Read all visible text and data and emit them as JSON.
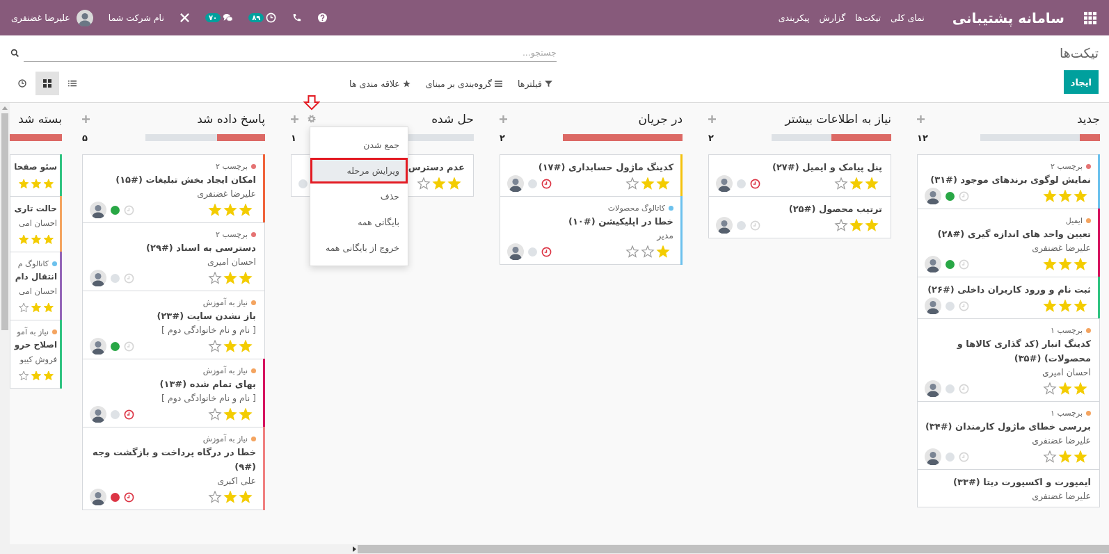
{
  "navbar": {
    "brand": "سامانه پشتیبانی",
    "menu": [
      "نمای کلی",
      "تیکت‌ها",
      "گزارش",
      "پیکربندی"
    ],
    "systray": [
      {
        "kind": "help"
      },
      {
        "kind": "phone"
      },
      {
        "kind": "activities",
        "badge": "۸۹"
      },
      {
        "kind": "messages",
        "badge": "۷۰"
      },
      {
        "kind": "tools"
      },
      {
        "kind": "company",
        "label": "نام شرکت شما"
      },
      {
        "kind": "user",
        "label": "علیرضا غضنفری"
      }
    ]
  },
  "control_panel": {
    "title": "تیکت‌ها",
    "search": {
      "placeholder": "جستجو..."
    },
    "create_button": "ایجاد",
    "filters": [
      {
        "kind": "filter",
        "label": "فیلترها"
      },
      {
        "kind": "group",
        "label": "گروه‌بندی بر مبنای"
      },
      {
        "kind": "favorite",
        "label": "علاقه مندی ها"
      }
    ],
    "views": [
      {
        "kind": "list",
        "selected": false
      },
      {
        "kind": "kanban",
        "selected": true
      },
      {
        "kind": "activity",
        "selected": false
      }
    ]
  },
  "columns": [
    {
      "title": "جدید",
      "count": "۱۲",
      "level": 0.17,
      "add_button": true,
      "cards": [
        {
          "tag": {
            "label": "برچسب ۲",
            "color": "#e57373"
          },
          "title": "نمایش لوگوی برندهای موجود (#۳۱)",
          "stars": 3,
          "status_dot": {
            "color": "#28a745"
          },
          "overdue": false,
          "avatar": true,
          "color": "#6cc1ed"
        },
        {
          "tag": {
            "label": "ایمیل",
            "color": "#f4a460"
          },
          "title": "تعیین واحد های اندازه گیری (#۲۸)",
          "person": "علیرضا غضنفری",
          "stars": 3,
          "status_dot": {
            "color": "#28a745"
          },
          "overdue": false,
          "avatar": true,
          "color": "#d6145f"
        },
        {
          "title": "ثبت نام و ورود کاربران داخلی (#۲۶)",
          "stars": 3,
          "status_dot": {
            "color": "#dee2e6"
          },
          "overdue": false,
          "avatar": true,
          "color": "#30c381"
        },
        {
          "tag": {
            "label": "برچسب ۱",
            "color": "#f4a460"
          },
          "title": "کدینگ انبار (کد گذاری کالاها و محصولات) (#۳۵)",
          "person": "احسان امیری",
          "stars": 2,
          "status_dot": {
            "color": "#dee2e6"
          },
          "overdue": false,
          "avatar": true
        },
        {
          "tag": {
            "label": "برچسب ۱",
            "color": "#f4a460"
          },
          "title": "بررسی خطای ماژول کارمندان (#۳۴)",
          "person": "علیرضا غضنفری",
          "stars": 2,
          "status_dot": {
            "color": "#dee2e6"
          },
          "overdue": false,
          "avatar": true
        },
        {
          "title": "ایمپورت و اکسپورت دیتا (#۳۳)",
          "person": "علیرضا غضنفری"
        }
      ]
    },
    {
      "title": "نیاز به اطلاعات بیشتر",
      "count": "۲",
      "level": 0.5,
      "add_button": true,
      "cards": [
        {
          "title": "پنل پیامک و ایمیل (#۲۷)",
          "stars": 2,
          "status_dot": {
            "color": "#dee2e6"
          },
          "overdue": true,
          "avatar": true
        },
        {
          "title": "ترتیب محصول (#۲۵)",
          "stars": 2,
          "status_dot": {
            "color": "#dee2e6"
          },
          "overdue": false,
          "avatar": true
        }
      ]
    },
    {
      "title": "در جریان",
      "count": "۲",
      "level": 1,
      "add_button": true,
      "cards": [
        {
          "title": "کدینگ ماژول حسابداری (#۱۷)",
          "stars": 2,
          "status_dot": {
            "color": "#dee2e6"
          },
          "overdue": true,
          "avatar": true,
          "color": "#f4c20d"
        },
        {
          "tag": {
            "label": "کاتالوگ محصولات",
            "color": "#6cc1ed"
          },
          "title": "خطا در اپلیکیشن (#۱۰)",
          "person": "مدیر",
          "stars": 1,
          "status_dot": {
            "color": "#dee2e6"
          },
          "overdue": true,
          "avatar": true,
          "color": "#6cc1ed"
        }
      ]
    },
    {
      "title": "حل شده",
      "count": "۱",
      "level": 0,
      "add_button": true,
      "menu": [
        {
          "label": "جمع شدن",
          "selected": false
        },
        {
          "label": "ویرایش مرحله",
          "selected": true
        },
        {
          "label": "حذف",
          "selected": false
        },
        {
          "label": "بایگانی همه",
          "selected": false
        },
        {
          "label": "خروج از بایگانی همه",
          "selected": false
        }
      ],
      "cards": [
        {
          "title": "عدم دسترس",
          "stars": 2,
          "status_dot": {
            "color": "#dee2e6"
          },
          "avatar": false
        }
      ]
    },
    {
      "title": "پاسخ داده شد",
      "count": "۵",
      "level": 0.4,
      "add_button": true,
      "cards": [
        {
          "tag": {
            "label": "برچسب ۲",
            "color": "#e57373"
          },
          "title": "امکان ایجاد بخش تبلیغات (#۱۵)",
          "person": "علیرضا غضنفری",
          "stars": 3,
          "status_dot": {
            "color": "#28a745"
          },
          "overdue": false,
          "avatar": true,
          "color": "#f0643c"
        },
        {
          "tag": {
            "label": "برچسب ۲",
            "color": "#e57373"
          },
          "title": "دسترسی به اسناد (#۲۹)",
          "person": "احسان امیری",
          "stars": 2,
          "status_dot": {
            "color": "#dee2e6"
          },
          "overdue": false,
          "avatar": true
        },
        {
          "tag": {
            "label": "نیاز به آموزش",
            "color": "#f4a460"
          },
          "title": "باز نشدن سایت (#۲۳)",
          "person": "[ نام و نام خانوادگی دوم ]",
          "stars": 2,
          "status_dot": {
            "color": "#28a745"
          },
          "overdue": false,
          "avatar": true
        },
        {
          "tag": {
            "label": "نیاز به آموزش",
            "color": "#f4a460"
          },
          "title": "بهای تمام شده (#۱۳)",
          "person": "[ نام و نام خانوادگی دوم ]",
          "stars": 2,
          "status_dot": {
            "color": "#dee2e6"
          },
          "overdue": true,
          "avatar": true,
          "color": "#d6145f"
        },
        {
          "tag": {
            "label": "نیاز به آموزش",
            "color": "#f4a460"
          },
          "title": "خطا در درگاه پرداخت و بازگشت وجه (#۹)",
          "person": "علی اکبری",
          "stars": 2,
          "status_dot": {
            "color": "#dc3545"
          },
          "overdue": true,
          "avatar": true,
          "color": "#f08080"
        }
      ]
    },
    {
      "title": "بسته شد",
      "level": 1,
      "add_button": false,
      "cards": [
        {
          "title": "سئو صفحا",
          "stars": 3,
          "color": "#30c381"
        },
        {
          "title": "حالت تاری",
          "person": "احسان امی",
          "stars": 3,
          "color": "#f4a460"
        },
        {
          "tag": {
            "label": "کاتالوگ م",
            "color": "#6cc1ed"
          },
          "title": "انتقال دام",
          "person": "احسان امی",
          "stars": 2,
          "color": "#9365b8"
        },
        {
          "tag": {
            "label": "نیاز به آمو",
            "color": "#f4a460"
          },
          "title": "اصلاح حرو",
          "person": "فروش کیبو",
          "stars": 2,
          "color": "#30c381"
        }
      ]
    }
  ]
}
